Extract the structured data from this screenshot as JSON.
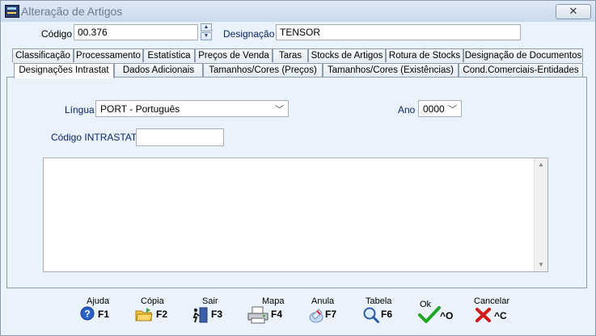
{
  "window": {
    "title": "Alteração de Artigos",
    "close_glyph": "✕"
  },
  "fields": {
    "codigo_label": "Código",
    "codigo_value": "00.376",
    "designacao_label": "Designação",
    "designacao_value": "TENSOR"
  },
  "tabs_row1": [
    "Classificação",
    "Processamento",
    "Estatística",
    "Preços de Venda",
    "Taras",
    "Stocks de Artigos",
    "Rotura de Stocks",
    "Designação de Documentos"
  ],
  "tabs_row2": [
    "Designações Intrastat",
    "Dados Adicionais",
    "Tamanhos/Cores (Preços)",
    "Tamanhos/Cores (Existências)",
    "Cond.Comerciais-Entidades"
  ],
  "active_tab": "Designações Intrastat",
  "panel": {
    "lingua_label": "Língua",
    "lingua_value": "PORT - Português",
    "ano_label": "Ano",
    "ano_value": "0000",
    "intrastat_label": "Código INTRASTAT",
    "intrastat_value": ""
  },
  "footer_buttons": [
    {
      "caption": "Ajuda",
      "key": "F1",
      "icon": "help-icon"
    },
    {
      "caption": "Cópia",
      "key": "F2",
      "icon": "copy-folder-icon"
    },
    {
      "caption": "Sair",
      "key": "F3",
      "icon": "exit-door-icon"
    },
    {
      "caption": "Mapa",
      "key": "F4",
      "icon": "printer-icon"
    },
    {
      "caption": "Anula",
      "key": "F7",
      "icon": "eraser-icon"
    },
    {
      "caption": "Tabela",
      "key": "F6",
      "icon": "magnifier-icon"
    },
    {
      "caption": "Ok",
      "key": "^O",
      "icon": "checkmark-icon"
    },
    {
      "caption": "Cancelar",
      "key": "^C",
      "icon": "cross-icon"
    }
  ],
  "colors": {
    "ok_green": "#1fa51f",
    "cancel_red": "#d21a1a",
    "help_blue": "#2b62c9"
  }
}
